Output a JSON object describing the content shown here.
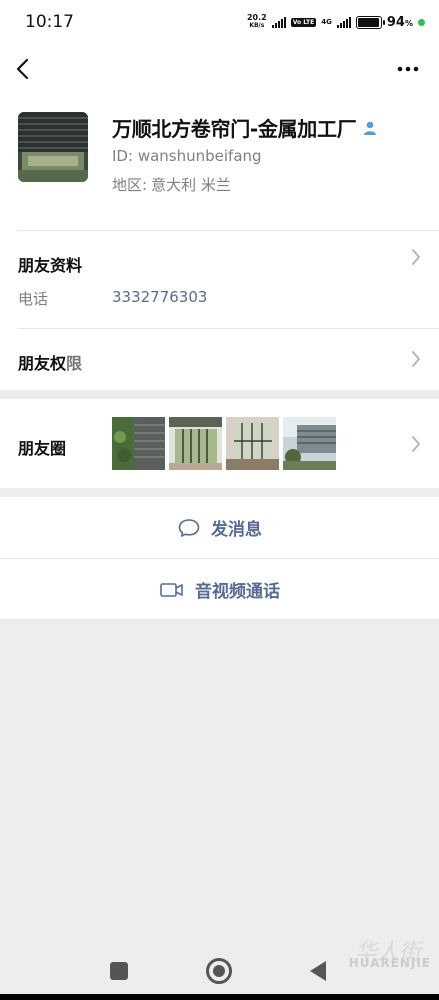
{
  "status": {
    "time": "10:17",
    "net_speed_value": "20.2",
    "net_speed_unit": "KB/s",
    "volte": "Vo LTE",
    "net_type": "4G",
    "battery": "94",
    "battery_unit": "%"
  },
  "profile": {
    "name": "万顺北方卷帘门-金属加工厂",
    "wxid_label": "ID:",
    "wxid": "wanshunbeifang",
    "region_label": "地区:",
    "region": "意大利  米兰",
    "avatar_text": "电话 3332776303"
  },
  "rows": {
    "friend_info": "朋友资料",
    "phone_label": "电话",
    "phone_value": "3332776303",
    "permissions_main": "朋友权",
    "permissions_tail": "限",
    "moments": "朋友圈"
  },
  "actions": {
    "message": "发消息",
    "call": "音视频通话"
  },
  "watermark": {
    "cn": "华人街",
    "en": "HUARENJIE"
  },
  "colors": {
    "link": "#576b95",
    "accent_green": "#2bc24e"
  }
}
